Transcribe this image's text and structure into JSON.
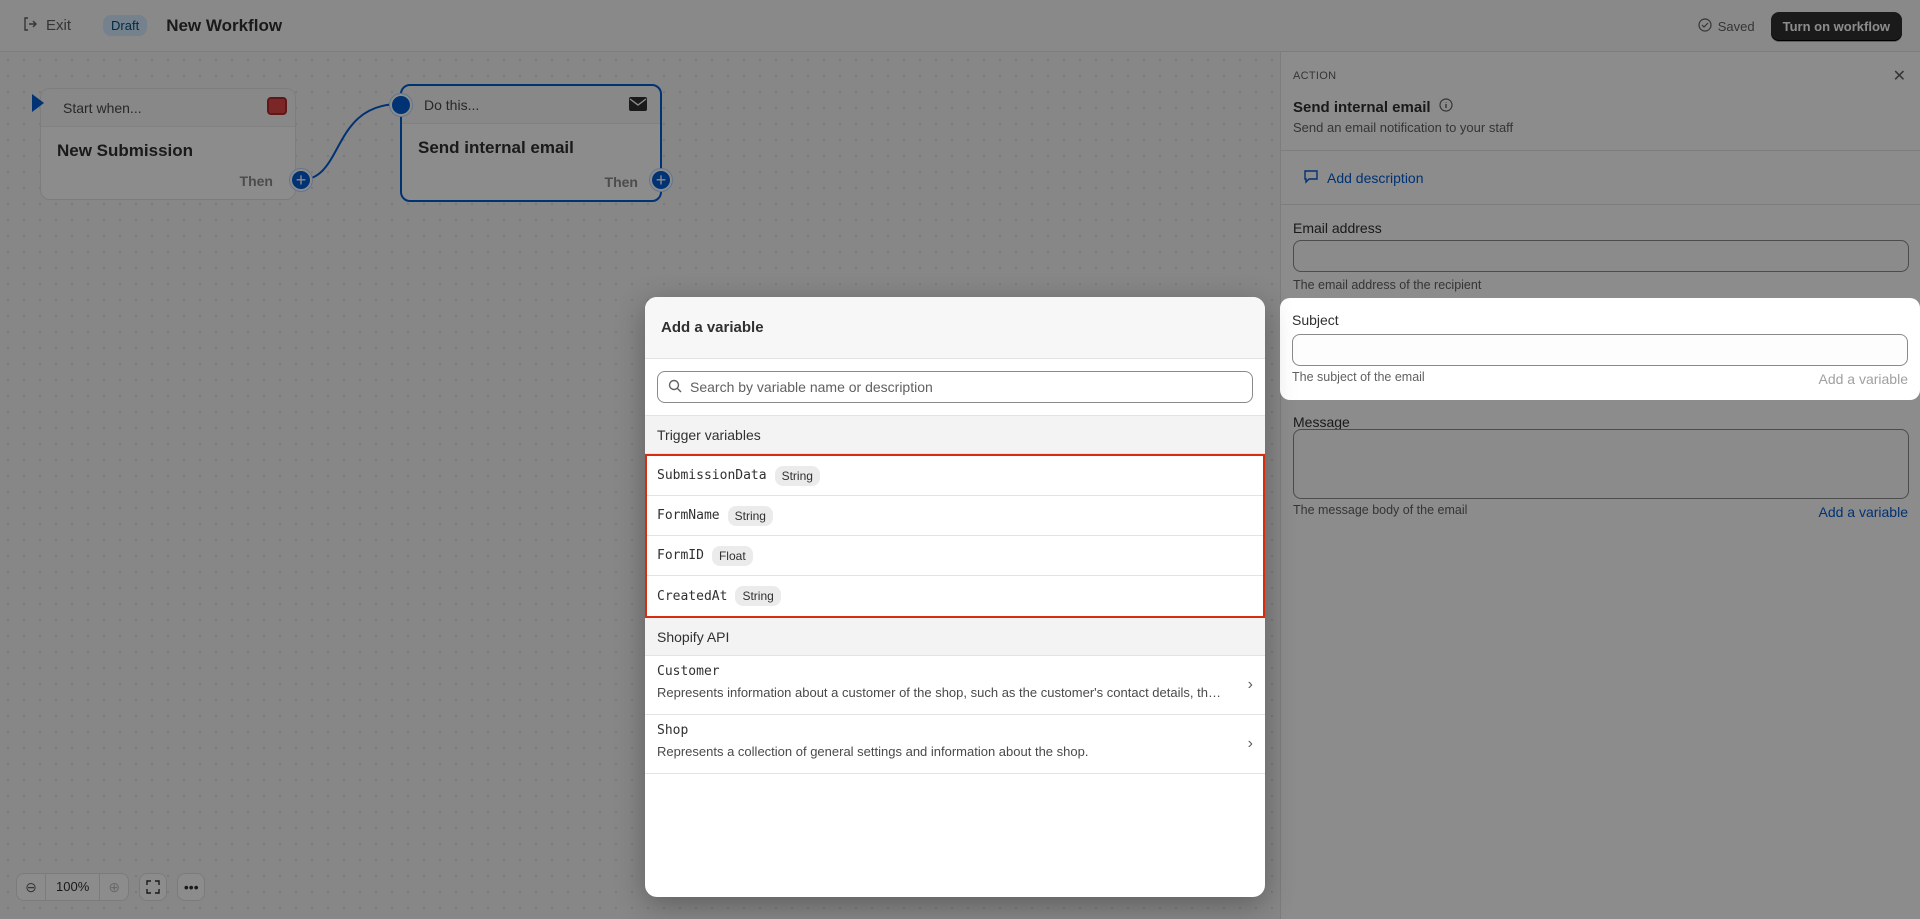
{
  "topbar": {
    "exit_label": "Exit",
    "draft_label": "Draft",
    "title": "New Workflow",
    "saved_label": "Saved",
    "turn_on_label": "Turn on workflow"
  },
  "canvas": {
    "trigger_node": {
      "header": "Start when...",
      "title": "New Submission",
      "then_label": "Then"
    },
    "action_node": {
      "header": "Do this...",
      "title": "Send internal email",
      "then_label": "Then"
    },
    "zoom_level": "100%"
  },
  "panel": {
    "eyebrow": "ACTION",
    "title": "Send internal email",
    "description": "Send an email notification to your staff",
    "add_description": "Add description",
    "fields": {
      "email": {
        "label": "Email address",
        "value": "",
        "help": "The email address of the recipient"
      },
      "subject": {
        "label": "Subject",
        "value": "",
        "help": "The subject of the email",
        "add_var": "Add a variable"
      },
      "message": {
        "label": "Message",
        "value": "",
        "help": "The message body of the email",
        "add_var": "Add a variable"
      }
    }
  },
  "modal": {
    "title": "Add a variable",
    "search_placeholder": "Search by variable name or description",
    "trigger_section": "Trigger variables",
    "trigger_vars": [
      {
        "name": "SubmissionData",
        "type": "String"
      },
      {
        "name": "FormName",
        "type": "String"
      },
      {
        "name": "FormID",
        "type": "Float"
      },
      {
        "name": "CreatedAt",
        "type": "String"
      }
    ],
    "api_section": "Shopify API",
    "api_items": [
      {
        "name": "Customer",
        "desc": "Represents information about a customer of the shop, such as the customer's contact details, thei..."
      },
      {
        "name": "Shop",
        "desc": "Represents a collection of general settings and information about the shop."
      }
    ]
  },
  "colors": {
    "accent": "#005bd3",
    "highlight_border": "#d72c0d"
  }
}
